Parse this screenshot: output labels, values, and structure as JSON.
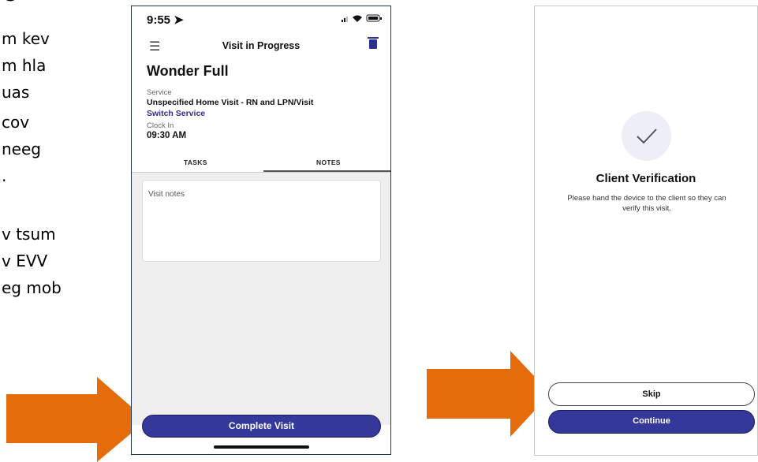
{
  "slide": {
    "heading_partial": "o",
    "lines": [
      "m kev",
      "m hla",
      "uas",
      "cov",
      "neeg",
      ".",
      "",
      "v tsum",
      "v EVV",
      "eg mob"
    ]
  },
  "phone1": {
    "status_time": "9:55",
    "status_icons": "signal wifi battery",
    "nav_title": "Visit in Progress",
    "client_name": "Wonder Full",
    "service_label": "Service",
    "service_value": "Unspecified Home Visit - RN and LPN/Visit",
    "switch_service": "Switch Service",
    "clock_in_label": "Clock In",
    "clock_in_value": "09:30 AM",
    "tabs": [
      {
        "label": "TASKS",
        "active": false
      },
      {
        "label": "NOTES",
        "active": true
      }
    ],
    "notes_placeholder": "Visit notes",
    "complete_button": "Complete Visit"
  },
  "phone2": {
    "title": "Client Verification",
    "description": "Please hand the device to the client so they can verify this visit.",
    "skip_button": "Skip",
    "continue_button": "Continue"
  },
  "colors": {
    "accent": "#34389a",
    "arrow": "#e46c0a"
  }
}
